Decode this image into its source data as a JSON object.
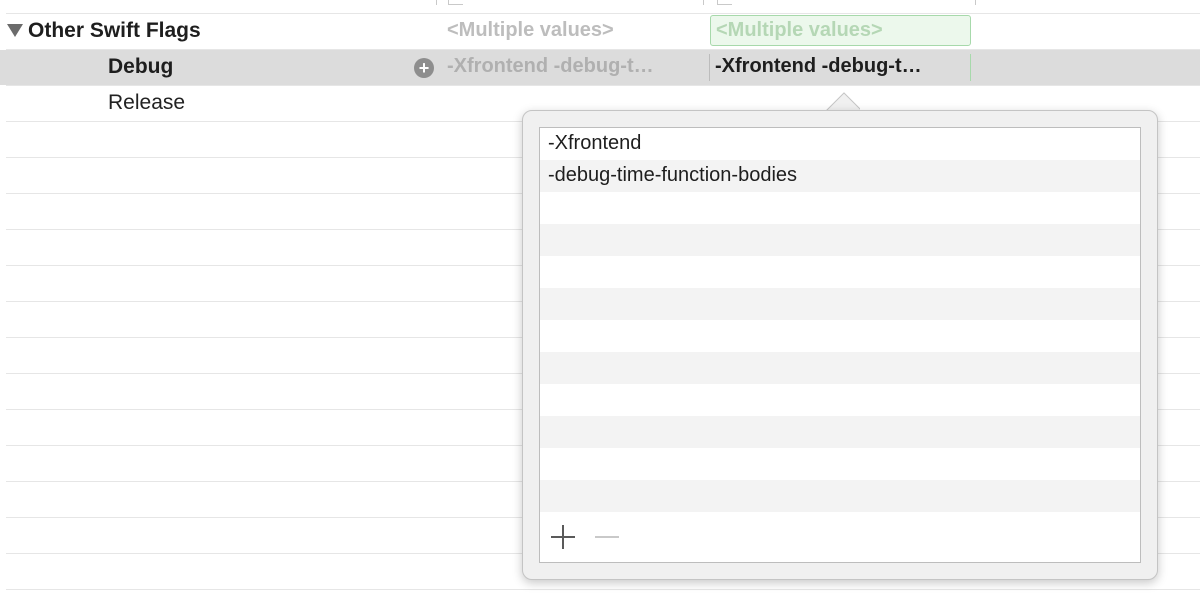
{
  "setting": {
    "title": "Other Swift Flags",
    "resolved_value": "<Multiple values>",
    "level_value": "<Multiple values>"
  },
  "configurations": [
    {
      "name": "Debug",
      "resolved_value": "-Xfrontend -debug-t…",
      "level_value": "-Xfrontend -debug-t…"
    },
    {
      "name": "Release"
    }
  ],
  "editor": {
    "items": [
      "-Xfrontend",
      "-debug-time-function-bodies"
    ],
    "add_symbol": "+",
    "remove_symbol": "−"
  },
  "colors": {
    "selected_row": "#dcdcdc",
    "level_highlight": "#ecf8ec",
    "level_border": "#a7d9ab"
  }
}
